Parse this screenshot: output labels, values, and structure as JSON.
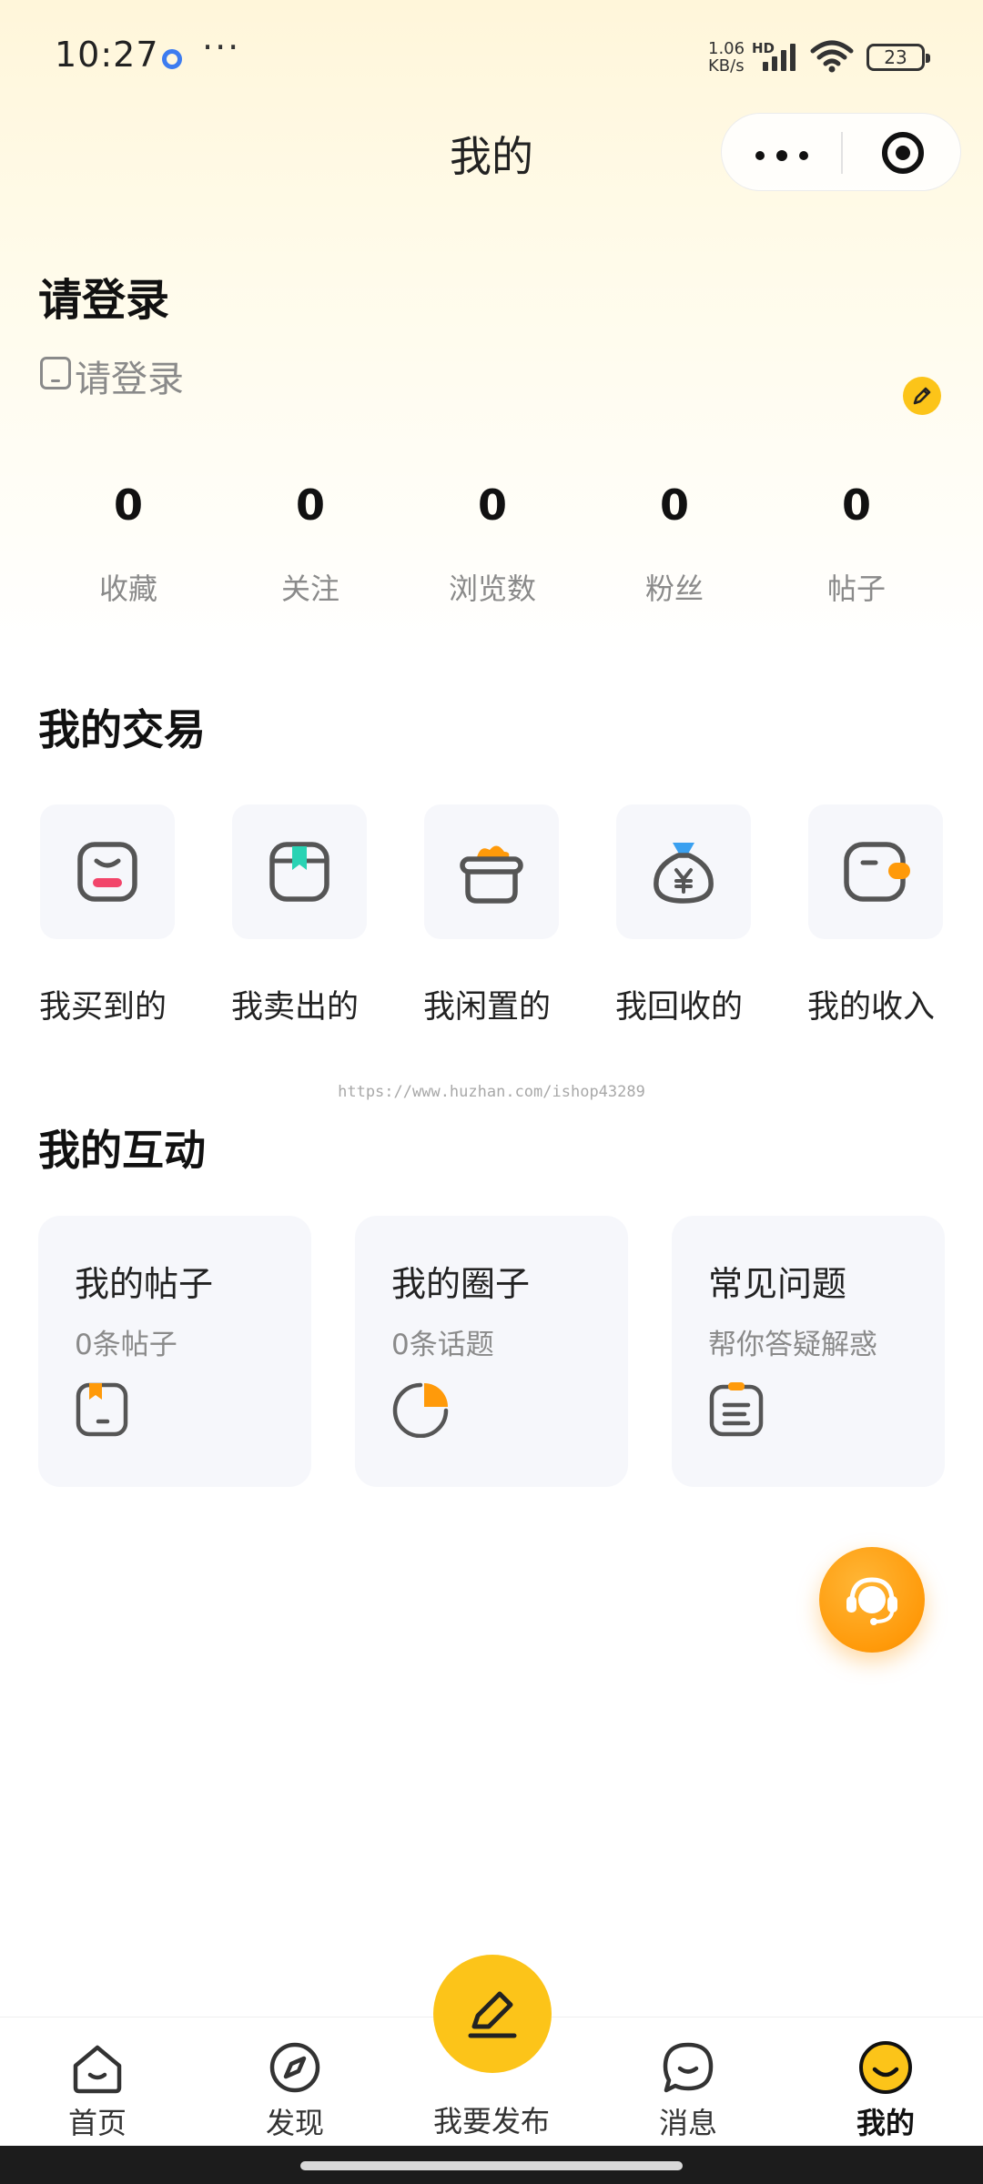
{
  "status_bar": {
    "time": "10:27",
    "more": "···",
    "speed_top": "1.06",
    "speed_bottom": "KB/s",
    "hd": "HD",
    "battery": "23"
  },
  "header": {
    "title": "我的",
    "more_icon": "more-dots-icon",
    "close_icon": "target-close-icon"
  },
  "profile": {
    "title": "请登录",
    "subtitle": "请登录",
    "edit_icon": "pencil-icon",
    "stats": [
      {
        "value": "0",
        "label": "收藏"
      },
      {
        "value": "0",
        "label": "关注"
      },
      {
        "value": "0",
        "label": "浏览数"
      },
      {
        "value": "0",
        "label": "粉丝"
      },
      {
        "value": "0",
        "label": "帖子"
      }
    ]
  },
  "trade": {
    "title": "我的交易",
    "items": [
      {
        "label": "我买到的",
        "icon": "bag-smile-icon"
      },
      {
        "label": "我卖出的",
        "icon": "box-bookmark-icon"
      },
      {
        "label": "我闲置的",
        "icon": "basket-icon"
      },
      {
        "label": "我回收的",
        "icon": "money-bag-icon"
      },
      {
        "label": "我的收入",
        "icon": "wallet-icon"
      }
    ]
  },
  "watermark": "https://www.huzhan.com/ishop43289",
  "interaction": {
    "title": "我的互动",
    "cards": [
      {
        "title": "我的帖子",
        "subtitle": "0条帖子",
        "icon": "post-icon"
      },
      {
        "title": "我的圈子",
        "subtitle": "0条话题",
        "icon": "circle-pie-icon"
      },
      {
        "title": "常见问题",
        "subtitle": "帮你答疑解惑",
        "icon": "clipboard-icon"
      }
    ]
  },
  "service_icon": "headset-icon",
  "tabbar": {
    "items": [
      {
        "label": "首页",
        "icon": "home-icon"
      },
      {
        "label": "发现",
        "icon": "compass-icon"
      },
      {
        "label": "我要发布",
        "icon": "pencil-icon"
      },
      {
        "label": "消息",
        "icon": "chat-icon"
      },
      {
        "label": "我的",
        "icon": "smile-face-icon"
      }
    ]
  },
  "colors": {
    "accent": "#fcc419",
    "orange": "#ff9a0a",
    "teal": "#29d3b4",
    "pink": "#f2456a",
    "card_bg": "#f6f7fb"
  }
}
